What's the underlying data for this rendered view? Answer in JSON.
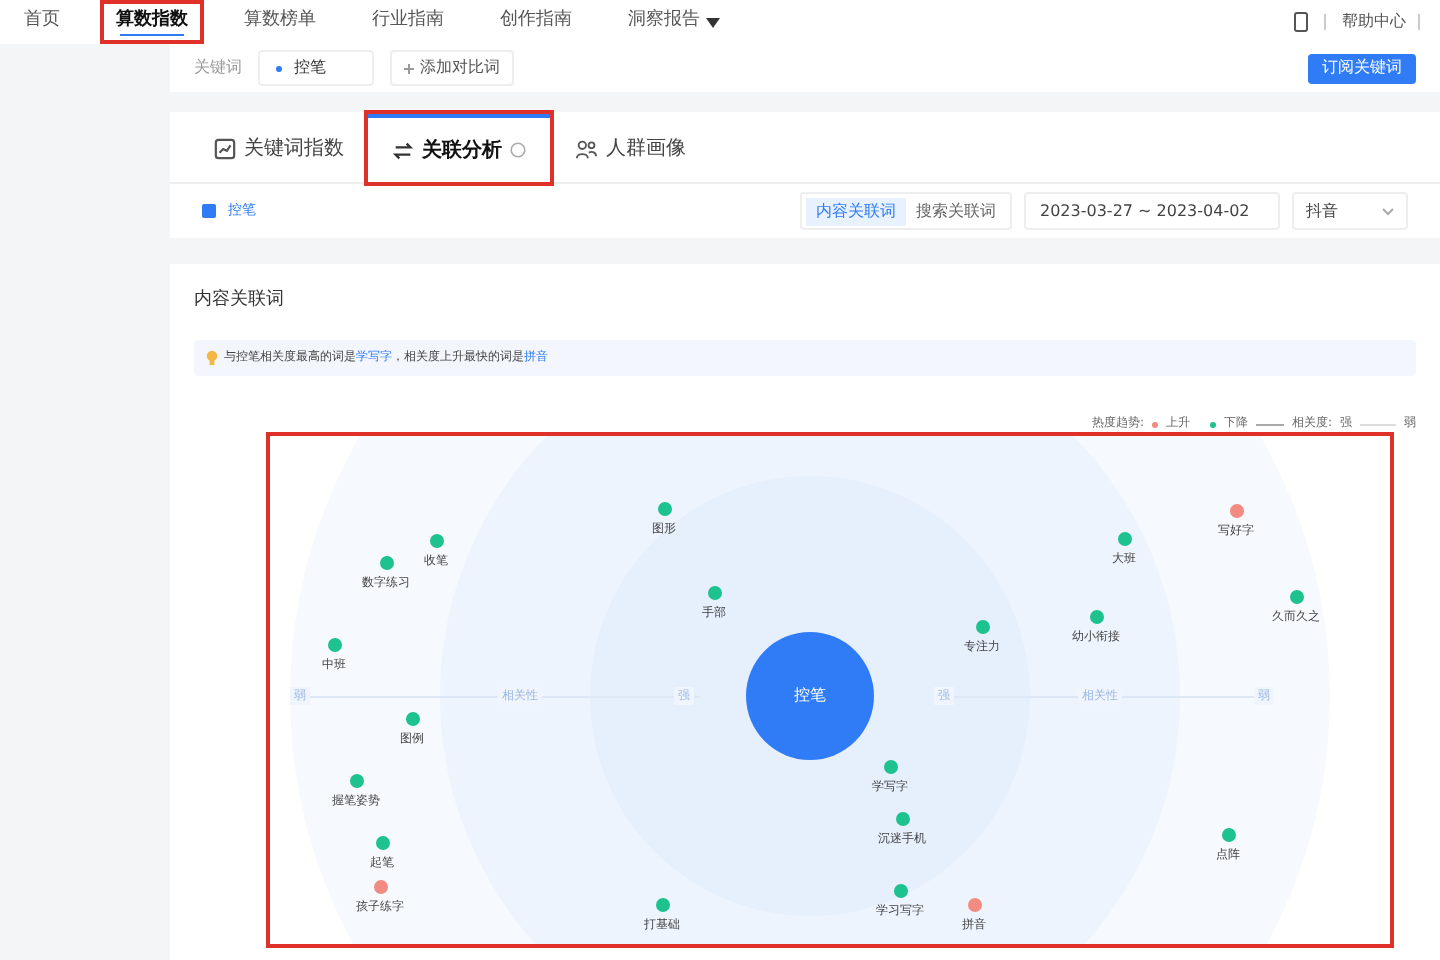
{
  "nav": {
    "items": [
      {
        "label": "首页",
        "selected": false,
        "highlighted": false
      },
      {
        "label": "算数指数",
        "selected": true,
        "highlighted": true
      },
      {
        "label": "算数榜单",
        "selected": false,
        "highlighted": false
      },
      {
        "label": "行业指南",
        "selected": false,
        "highlighted": false
      },
      {
        "label": "创作指南",
        "selected": false,
        "highlighted": false
      },
      {
        "label": "洞察报告",
        "selected": false,
        "highlighted": false,
        "dropdown": true
      }
    ],
    "help": "帮助中心"
  },
  "keyword_bar": {
    "label": "关键词",
    "keyword": "控笔",
    "add": "添加对比词",
    "subscribe": "订阅关键词"
  },
  "tabs": [
    {
      "label": "关键词指数",
      "selected": false,
      "highlighted": false,
      "kind": "index"
    },
    {
      "label": "关联分析",
      "selected": true,
      "highlighted": true,
      "kind": "relation"
    },
    {
      "label": "人群画像",
      "selected": false,
      "highlighted": false,
      "kind": "crowd"
    }
  ],
  "filter": {
    "keyword": "控笔",
    "checked": true,
    "segments": [
      {
        "label": "内容关联词",
        "selected": true
      },
      {
        "label": "搜索关联词",
        "selected": false
      }
    ],
    "date_range": "2023-03-27 ~ 2023-04-02",
    "platform": "抖音"
  },
  "card": {
    "title": "内容关联词",
    "tip": [
      {
        "text": "与控笔相关度最高的词是",
        "link": false
      },
      {
        "text": "学写字",
        "link": true
      },
      {
        "text": "，相关度上升最快的词是",
        "link": false
      },
      {
        "text": "拼音",
        "link": true
      }
    ],
    "legend": {
      "trend_label": "热度趋势:",
      "up": "上升",
      "down": "下降",
      "relevance_label": "相关度:",
      "strong": "强",
      "weak": "弱"
    },
    "chart": {
      "highlighted": true,
      "center": "控笔",
      "axis": [
        "弱",
        "相关性",
        "强",
        "强",
        "相关性",
        "弱"
      ],
      "nodes": [
        {
          "label": "图形",
          "color": "#1dc28f"
        },
        {
          "label": "手部",
          "color": "#1dc28f"
        },
        {
          "label": "收笔",
          "color": "#1dc28f"
        },
        {
          "label": "数字练习",
          "color": "#1dc28f"
        },
        {
          "label": "中班",
          "color": "#1dc28f"
        },
        {
          "label": "图例",
          "color": "#1dc28f"
        },
        {
          "label": "握笔姿势",
          "color": "#1dc28f"
        },
        {
          "label": "起笔",
          "color": "#1dc28f"
        },
        {
          "label": "孩子练字",
          "color": "#f28b82"
        },
        {
          "label": "打基础",
          "color": "#1dc28f"
        },
        {
          "label": "写好字",
          "color": "#f28b82"
        },
        {
          "label": "大班",
          "color": "#1dc28f"
        },
        {
          "label": "久而久之",
          "color": "#1dc28f"
        },
        {
          "label": "专注力",
          "color": "#1dc28f"
        },
        {
          "label": "幼小衔接",
          "color": "#1dc28f"
        },
        {
          "label": "学写字",
          "color": "#1dc28f"
        },
        {
          "label": "沉迷手机",
          "color": "#1dc28f"
        },
        {
          "label": "学习写字",
          "color": "#1dc28f"
        },
        {
          "label": "拼音",
          "color": "#f28b82"
        },
        {
          "label": "点阵",
          "color": "#1dc28f"
        }
      ]
    }
  }
}
